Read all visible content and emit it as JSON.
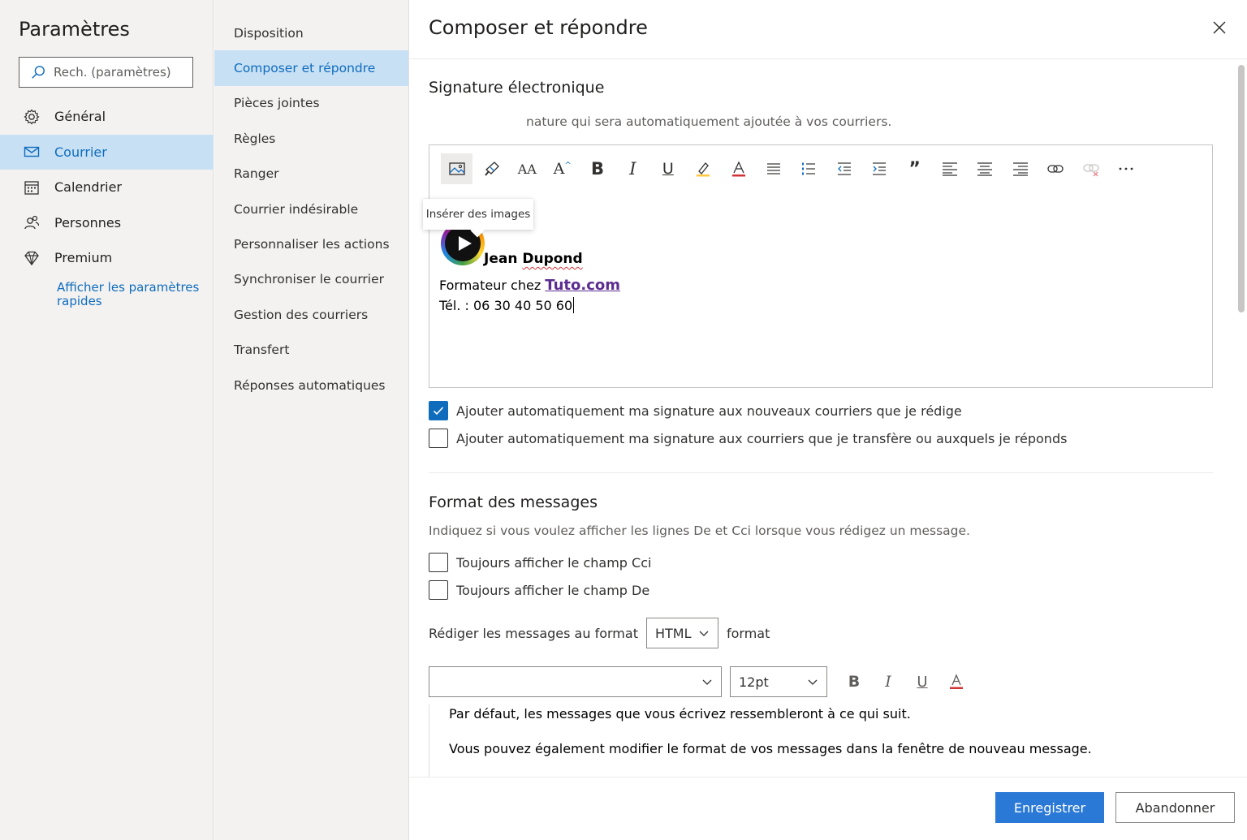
{
  "app": {
    "title": "Paramètres"
  },
  "search": {
    "placeholder": "Rech. (paramètres)"
  },
  "nav": {
    "items": [
      {
        "label": "Général",
        "icon": "gear-icon"
      },
      {
        "label": "Courrier",
        "icon": "mail-icon",
        "active": true
      },
      {
        "label": "Calendrier",
        "icon": "calendar-icon"
      },
      {
        "label": "Personnes",
        "icon": "people-icon"
      },
      {
        "label": "Premium",
        "icon": "diamond-icon"
      }
    ],
    "quick_settings_link": "Afficher les paramètres rapides"
  },
  "subnav": {
    "items": [
      {
        "label": "Disposition"
      },
      {
        "label": "Composer et répondre",
        "active": true
      },
      {
        "label": "Pièces jointes"
      },
      {
        "label": "Règles"
      },
      {
        "label": "Ranger"
      },
      {
        "label": "Courrier indésirable"
      },
      {
        "label": "Personnaliser les actions"
      },
      {
        "label": "Synchroniser le courrier"
      },
      {
        "label": "Gestion des courriers"
      },
      {
        "label": "Transfert"
      },
      {
        "label": "Réponses automatiques"
      }
    ]
  },
  "panel": {
    "title": "Composer et répondre",
    "signature": {
      "title": "Signature électronique",
      "description": "Créez une signature qui sera automatiquement ajoutée à vos courriers.",
      "description_visible": "nature qui sera automatiquement ajoutée à vos courriers.",
      "tooltip": "Insérer des images",
      "toolbar_icons": [
        "image-icon",
        "format-painter-icon",
        "font-size-icon",
        "grow-font-icon",
        "bold-icon",
        "italic-icon",
        "underline-icon",
        "highlight-icon",
        "font-color-icon",
        "bullets-icon",
        "numbering-icon",
        "decrease-indent-icon",
        "increase-indent-icon",
        "quote-icon",
        "align-left-icon",
        "align-center-icon",
        "align-right-icon",
        "link-icon",
        "unlink-icon",
        "more-icon"
      ],
      "content": {
        "name": "Jean Dupond",
        "name_first": "Jean ",
        "name_last": "Dupond",
        "line2_prefix": "Formateur chez ",
        "line2_brand": "Tuto.com",
        "line3": "Tél. : 06 30 40 50 60"
      },
      "options": [
        {
          "label": "Ajouter automatiquement ma signature aux nouveaux courriers que je rédige",
          "checked": true
        },
        {
          "label": "Ajouter automatiquement ma signature aux courriers que je transfère ou auxquels je réponds",
          "checked": false
        }
      ]
    },
    "format": {
      "title": "Format des messages",
      "description": "Indiquez si vous voulez afficher les lignes De et Cci lorsque vous rédigez un message.",
      "options": [
        {
          "label": "Toujours afficher le champ Cci",
          "checked": false
        },
        {
          "label": "Toujours afficher le champ De",
          "checked": false
        }
      ],
      "compose_prefix": "Rédiger les messages au format",
      "compose_value": "HTML",
      "compose_suffix": "format",
      "font_family_value": "",
      "font_size_value": "12pt",
      "preview_line1": "Par défaut, les messages que vous écrivez ressembleront à ce qui suit.",
      "preview_line2": "Vous pouvez également modifier le format de vos messages dans la fenêtre de nouveau message."
    },
    "footer": {
      "save_label": "Enregistrer",
      "cancel_label": "Abandonner"
    }
  },
  "colors": {
    "accent": "#0f6cbd",
    "active_bg": "#c7e0f4",
    "primary_button": "#2b79d6",
    "brand_link": "#5c2d91"
  }
}
